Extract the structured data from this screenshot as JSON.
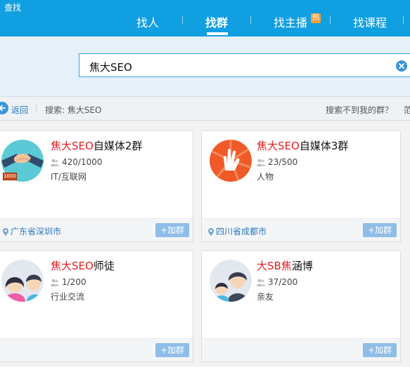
{
  "app": {
    "title": "查找"
  },
  "nav": {
    "items": [
      {
        "label": "找人"
      },
      {
        "label": "找群"
      },
      {
        "label": "找主播"
      },
      {
        "label": "找课程"
      }
    ],
    "hot_badge": "热"
  },
  "search": {
    "value": "焦大SEO"
  },
  "breadcrumb": {
    "back": "返回",
    "search_info": "搜索: 焦大SEO",
    "not_found": "搜索不到我的群？",
    "cut_link": "范"
  },
  "groups": [
    {
      "name_highlight": "焦大SEO",
      "name_rest": "自媒体2群",
      "members": "420/1000",
      "category": "IT/互联网",
      "location": "广东省深圳市",
      "join": "+加群",
      "badge": "1000"
    },
    {
      "name_highlight": "焦大SEO",
      "name_rest": "自媒体3群",
      "members": "23/500",
      "category": "人物",
      "location": "四川省成都市",
      "join": "+加群"
    },
    {
      "name_highlight": "焦大SEO",
      "name_rest": "师徒",
      "members": "1/200",
      "category": "行业交流",
      "location": "",
      "join": "+加群"
    },
    {
      "name_parts": [
        "大SB",
        "焦",
        "涵博"
      ],
      "members": "37/200",
      "category": "亲友",
      "location": "",
      "join": "+加群"
    }
  ],
  "colors": {
    "topbar": "#109fe1",
    "highlight": "#e51c23",
    "link": "#2b79c2",
    "join_button": "#8fbde7"
  }
}
